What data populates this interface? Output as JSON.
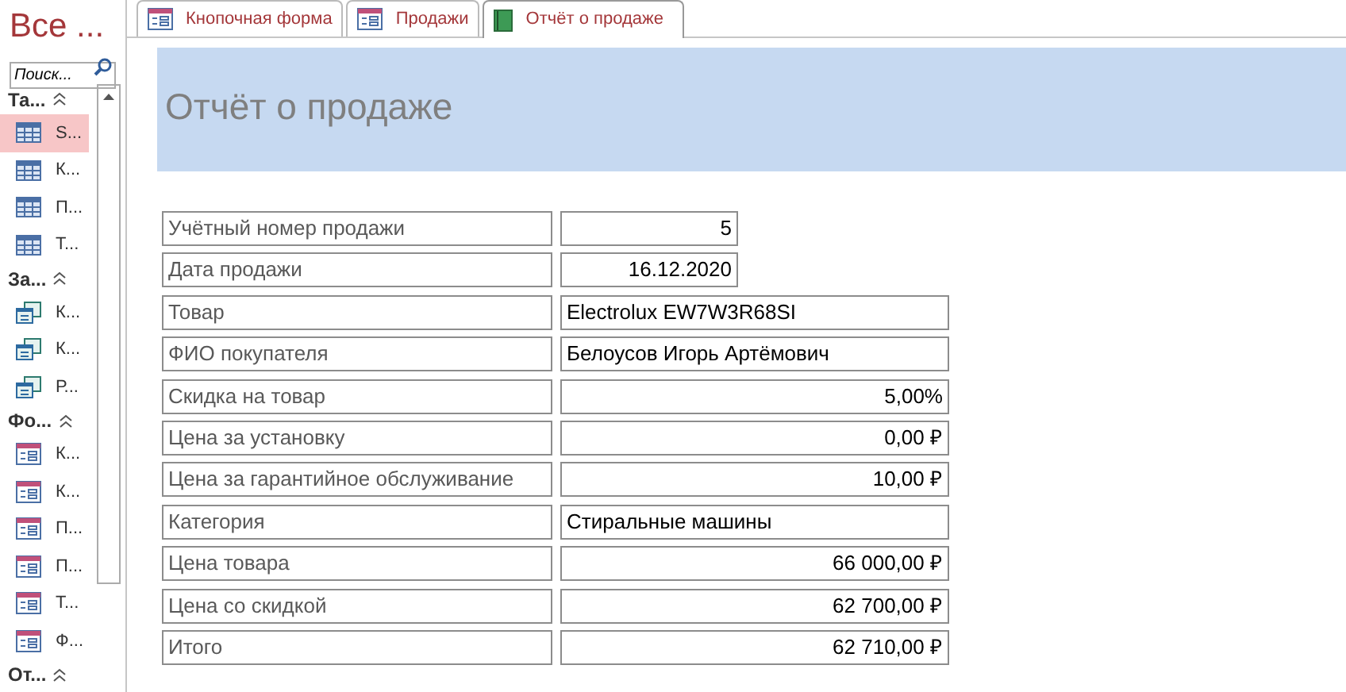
{
  "nav": {
    "title": "Все ...",
    "search": {
      "placeholder": "Поиск..."
    },
    "groups": [
      {
        "label": "Та...",
        "expanded": true,
        "kind": "table",
        "items": [
          {
            "label": "S...",
            "selected": true
          },
          {
            "label": "К...",
            "selected": false
          },
          {
            "label": "П...",
            "selected": false
          },
          {
            "label": "Т...",
            "selected": false
          }
        ]
      },
      {
        "label": "За...",
        "expanded": true,
        "kind": "query",
        "items": [
          {
            "label": "К...",
            "selected": false
          },
          {
            "label": "К...",
            "selected": false
          },
          {
            "label": "Р...",
            "selected": false
          }
        ]
      },
      {
        "label": "Фо...",
        "expanded": true,
        "kind": "form",
        "items": [
          {
            "label": "К...",
            "selected": false
          },
          {
            "label": "К...",
            "selected": false
          },
          {
            "label": "П...",
            "selected": false
          },
          {
            "label": "П...",
            "selected": false
          },
          {
            "label": "Т...",
            "selected": false
          },
          {
            "label": "Ф...",
            "selected": false
          }
        ]
      },
      {
        "label": "От...",
        "expanded": true
      }
    ]
  },
  "tabs": [
    {
      "label": "Кнопочная форма",
      "kind": "form",
      "selected": false
    },
    {
      "label": "Продажи",
      "kind": "form",
      "selected": false
    },
    {
      "label": "Отчёт о продаже",
      "kind": "report",
      "selected": true
    }
  ],
  "report": {
    "title": "Отчёт о продаже",
    "fields": [
      {
        "label": "Учётный номер продажи",
        "value": "5",
        "kind": "short"
      },
      {
        "label": "Дата продажи",
        "value": "16.12.2020",
        "kind": "short"
      },
      {
        "label": "Товар",
        "value": "Electrolux EW7W3R68SI",
        "kind": "text"
      },
      {
        "label": "ФИО покупателя",
        "value": "Белоусов Игорь Артёмович",
        "kind": "text"
      },
      {
        "label": "Скидка на товар",
        "value": "5,00%",
        "kind": "number"
      },
      {
        "label": "Цена за установку",
        "value": "0,00 ₽",
        "kind": "number"
      },
      {
        "label": "Цена за гарантийное обслуживание",
        "value": "10,00 ₽",
        "kind": "number"
      },
      {
        "label": "Категория",
        "value": "Стиральные машины",
        "kind": "text"
      },
      {
        "label": "Цена товара",
        "value": "66 000,00 ₽",
        "kind": "number"
      },
      {
        "label": "Цена со скидкой",
        "value": "62 700,00 ₽",
        "kind": "number"
      },
      {
        "label": "Итого",
        "value": "62 710,00 ₽",
        "kind": "number"
      }
    ]
  }
}
